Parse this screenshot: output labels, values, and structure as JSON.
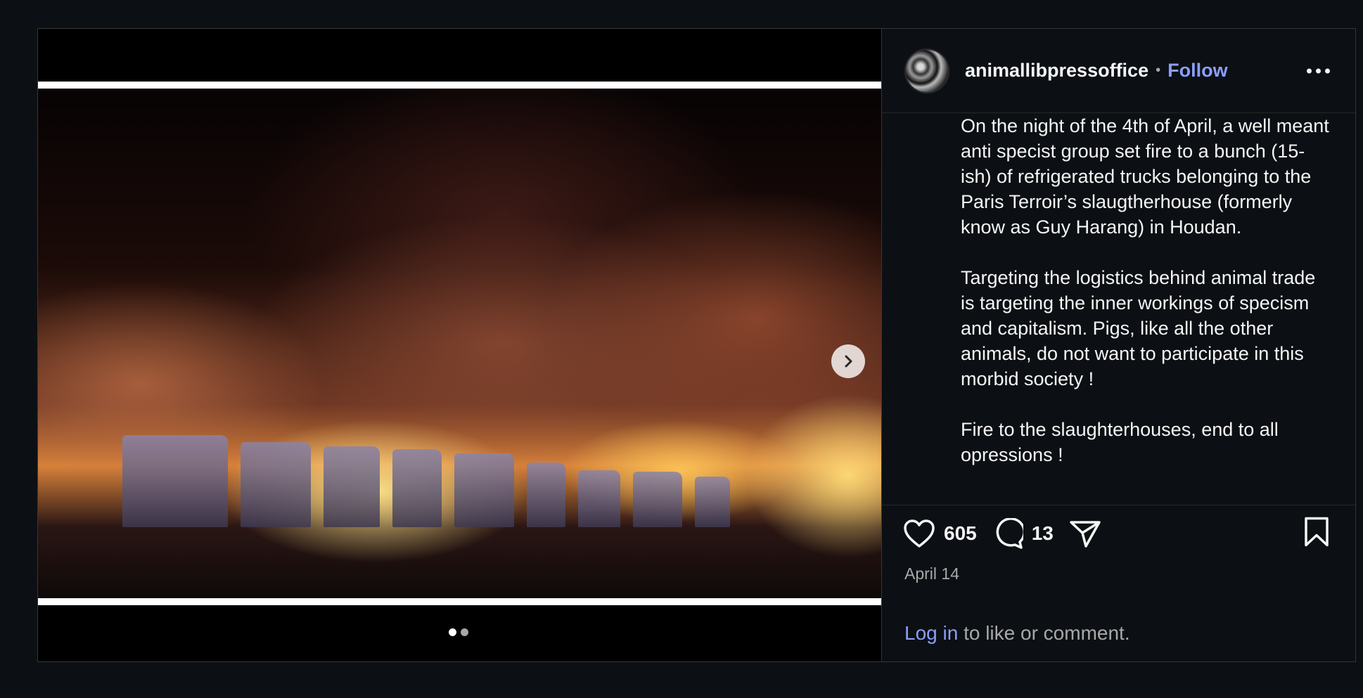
{
  "post": {
    "username": "animallibpressoffice",
    "separator": "•",
    "follow_label": "Follow",
    "caption_paragraphs": [
      "On the night of the 4th of April, a well meant anti specist group set fire to a bunch (15-ish) of refrigerated trucks belonging to the Paris Terroir’s slaugtherhouse (formerly know as Guy Harang) in Houdan.",
      "Targeting the logistics behind animal trade is targeting the inner workings of specism and capitalism. Pigs, like all the other animals, do not want to participate in this morbid society !",
      "Fire to the slaughterhouses, end to all opressions !"
    ],
    "likes": "605",
    "comments": "13",
    "date": "April 14",
    "login_link": "Log in",
    "login_suffix": " to like or comment."
  },
  "carousel": {
    "slide_count": 2,
    "active_index": 0
  },
  "icons": {
    "like": "heart-icon",
    "comment": "comment-bubble-icon",
    "share": "paper-plane-icon",
    "save": "bookmark-icon",
    "more": "more-options-icon",
    "next": "chevron-right-icon"
  },
  "colors": {
    "background": "#0c1014",
    "accent_link": "#8c9ef8",
    "text": "#f5f5f5",
    "muted": "#a8a8a8"
  }
}
